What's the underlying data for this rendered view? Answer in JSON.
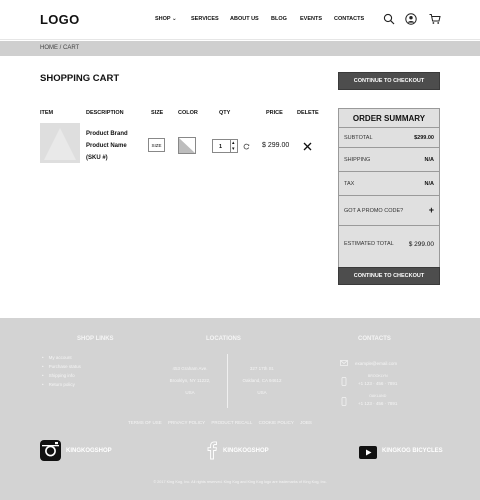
{
  "header": {
    "logo": "LOGO",
    "nav": [
      "SHOP ⌄",
      "SERVICES",
      "ABOUT US",
      "BLOG",
      "EVENTS",
      "CONTACTS"
    ]
  },
  "breadcrumb": "HOME / CART",
  "cart": {
    "title": "SHOPPING CART",
    "checkout_label": "CONTINUE TO CHECKOUT",
    "columns": [
      "ITEM",
      "DESCRIPTION",
      "SIZE",
      "COLOR",
      "QTY",
      "PRICE",
      "DELETE"
    ],
    "item": {
      "brand": "Product Brand",
      "name": "Product Name",
      "sku": "(SKU #)",
      "size": "SIZE",
      "qty": "1",
      "price": "$ 299.00"
    }
  },
  "summary": {
    "title": "ORDER SUMMARY",
    "subtotal_label": "SUBTOTAL",
    "subtotal_value": "$299.00",
    "shipping_label": "SHIPPING",
    "shipping_value": "N/A",
    "tax_label": "TAX",
    "tax_value": "N/A",
    "promo_label": "GOT A PROMO CODE?",
    "promo_icon": "+",
    "total_label": "ESTIMATED TOTAL",
    "total_value": "$ 299.00",
    "checkout_label": "CONTINUE TO CHECKOUT"
  },
  "footer": {
    "shop_links_title": "SHOP LINKS",
    "shop_links": [
      "My account",
      "Purchase status",
      "Shipping info",
      "Return policy"
    ],
    "locations_title": "LOCATIONS",
    "location1": [
      "453 Graham Ave.",
      "Brooklyn, NY 11222,",
      "USA"
    ],
    "location2": [
      "327 17th St.",
      "Oakland, CA 94612",
      "USA"
    ],
    "contacts_title": "CONTACTS",
    "email": "example@email.com",
    "phone1_label": "BROOKLYN",
    "phone1": "+1 123 · 456 · 7891",
    "phone2_label": "OAKLAND",
    "phone2": "+1 123 · 456 · 7891",
    "links": [
      "TERMS OF USE",
      "PRIVACY POLICY",
      "PRODUCT RECALL",
      "COOKIE POLICY",
      "JOBS"
    ],
    "social": {
      "instagram": "KINGKOGSHOP",
      "facebook": "KINGKOGSHOP",
      "youtube": "KINGKOG BICYCLES"
    },
    "copyright": "© 2017 King Kog, Inc. All rights reserved. King Kog and King Kog logo are trademarks of King Kog, Inc."
  }
}
